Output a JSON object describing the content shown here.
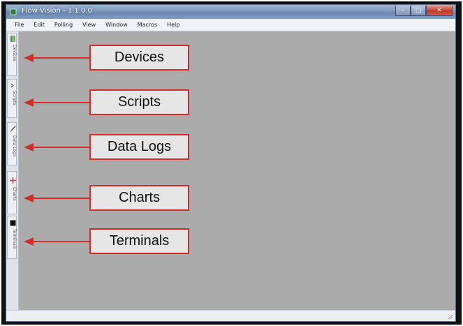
{
  "window": {
    "title": "Flow Vision - 1.1.0.0",
    "controls": [
      "–",
      "□",
      "✕"
    ]
  },
  "menu": [
    "File",
    "Edit",
    "Polling",
    "View",
    "Window",
    "Macros",
    "Help"
  ],
  "sidebar": {
    "tabs": [
      {
        "label": "Devices",
        "icon": "devices-icon"
      },
      {
        "label": "Scripts",
        "icon": "scripts-icon"
      },
      {
        "label": "Data Logs",
        "icon": "data-logs-icon"
      },
      {
        "label": "Charts",
        "icon": "charts-icon"
      },
      {
        "label": "Terminals",
        "icon": "terminals-icon"
      }
    ]
  },
  "callouts": [
    "Devices",
    "Scripts",
    "Data Logs",
    "Charts",
    "Terminals"
  ],
  "colors": {
    "callout_border": "#d42b2b",
    "arrow": "#d42b2b",
    "workspace": "#ababab"
  }
}
